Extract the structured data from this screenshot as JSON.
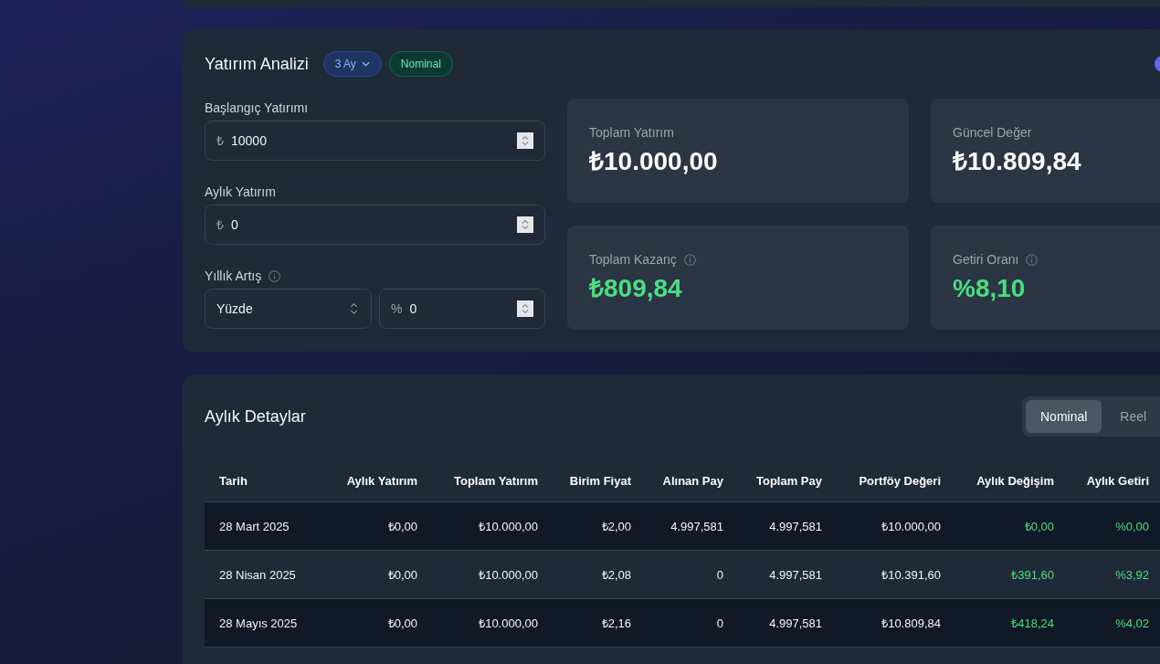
{
  "analysis": {
    "title": "Yatırım Analizi",
    "pills": [
      {
        "kind": "dropdown",
        "label": "3 Ay"
      },
      {
        "kind": "badge",
        "label": "Nominal"
      }
    ],
    "fields": [
      {
        "label": "Başlangıç Yatırımı",
        "prefix": "₺",
        "value": "10000"
      },
      {
        "label": "Aylık Yatırım",
        "prefix": "₺",
        "value": "0"
      }
    ],
    "annual_increase": {
      "label": "Yıllık Artış",
      "info_icon": true,
      "mode": "Yüzde",
      "prefix": "%",
      "value": "0"
    },
    "stats": [
      {
        "label": "Toplam Yatırım",
        "value": "₺10.000,00",
        "info_icon": false,
        "kind": "total"
      },
      {
        "label": "Güncel Değer",
        "value": "₺10.809,84",
        "info_icon": false,
        "kind": "total"
      },
      {
        "label": "Toplam Kazanç",
        "value": "₺809,84",
        "info_icon": true,
        "kind": "gain"
      },
      {
        "label": "Getiri Oranı",
        "value": "%8,10",
        "info_icon": true,
        "kind": "gain"
      }
    ]
  },
  "monthly_details": {
    "title": "Aylık Detaylar",
    "view_options": [
      {
        "label": "Nominal",
        "selected": true
      },
      {
        "label": "Reel",
        "selected": false
      }
    ],
    "table": {
      "columns": [
        {
          "label": "Tarih",
          "kind": "date"
        },
        {
          "label": "Aylık Yatırım",
          "kind": "amount"
        },
        {
          "label": "Toplam Yatırım",
          "kind": "amount"
        },
        {
          "label": "Birim Fiyat",
          "kind": "amount"
        },
        {
          "label": "Alınan Pay",
          "kind": "amount"
        },
        {
          "label": "Toplam Pay",
          "kind": "amount"
        },
        {
          "label": "Portföy Değeri",
          "kind": "amount"
        },
        {
          "label": "Aylık Değişim",
          "kind": "change"
        },
        {
          "label": "Aylık Getiri",
          "kind": "change"
        }
      ],
      "rows": [
        [
          "28 Mart 2025",
          "₺0,00",
          "₺10.000,00",
          "₺2,00",
          "4.997,581",
          "4.997,581",
          "₺10.000,00",
          "₺0,00",
          "%0,00"
        ],
        [
          "28 Nisan 2025",
          "₺0,00",
          "₺10.000,00",
          "₺2,08",
          "0",
          "4.997,581",
          "₺10.391,60",
          "₺391,60",
          "%3,92"
        ],
        [
          "28 Mayıs 2025",
          "₺0,00",
          "₺10.000,00",
          "₺2,16",
          "0",
          "4.997,581",
          "₺10.809,84",
          "₺418,24",
          "%4,02"
        ]
      ]
    }
  }
}
